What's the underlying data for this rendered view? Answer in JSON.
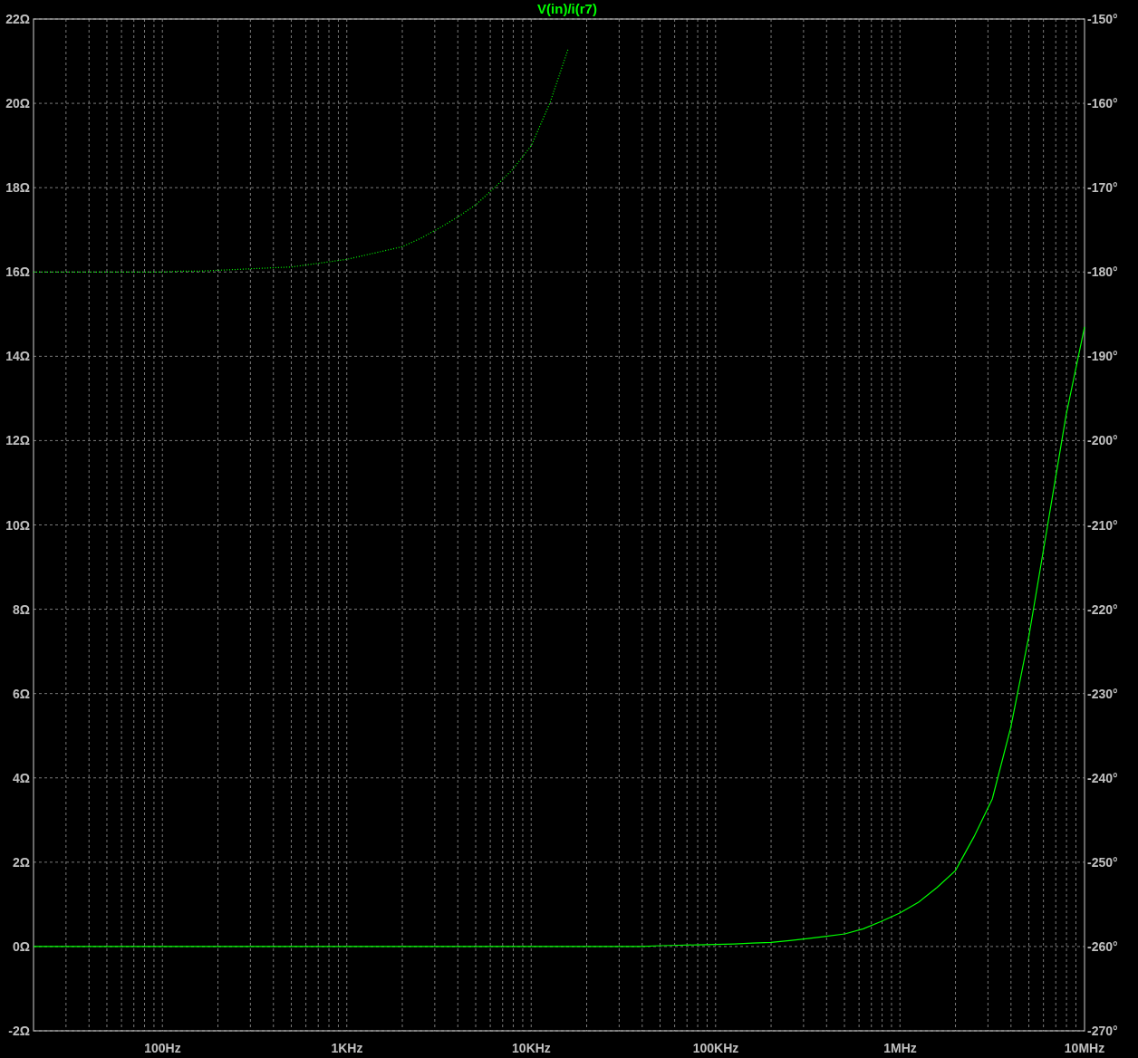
{
  "plot": {
    "chart_data": {
      "type": "line",
      "title": "V(in)/i(r7)",
      "categories": [
        null,
        null,
        null,
        null,
        null,
        null,
        null,
        "100Hz",
        null,
        null,
        null,
        null,
        null,
        null,
        null,
        null,
        null,
        "1KHz",
        null,
        null,
        null,
        null,
        null,
        null,
        null,
        null,
        null,
        "10KHz",
        null,
        null,
        null,
        null,
        null,
        null,
        null,
        null,
        null,
        "100KHz",
        null,
        null,
        null,
        null,
        null,
        null,
        null,
        null,
        null,
        "1MHz",
        null,
        null,
        null,
        null,
        null,
        null,
        null,
        null,
        null,
        "10MHz"
      ],
      "series": [
        {
          "color": "#00ff00",
          "values": [
            0,
            0,
            0,
            0,
            0,
            0,
            0,
            0,
            0,
            0,
            0,
            0,
            0,
            0,
            0,
            0,
            0,
            0,
            0,
            0,
            0,
            0,
            0,
            0,
            0,
            0,
            0,
            0,
            0,
            0,
            0,
            0,
            0,
            0,
            0.02,
            0.03,
            0.04,
            0.05,
            0.06,
            0.08,
            0.1,
            0.14,
            0.19,
            0.24,
            0.3,
            0.42,
            0.6,
            0.8,
            1.05,
            1.4,
            1.8,
            2.6,
            3.5,
            5.2,
            7.4,
            10.0,
            12.6,
            14.7
          ]
        },
        {
          "color": "#00ff00",
          "axis": "y2",
          "line_style": "dotted",
          "values": [
            -180,
            -180,
            -180,
            -180,
            -180,
            -180,
            -180,
            -180,
            -179.9,
            -179.9,
            -179.8,
            -179.7,
            -179.6,
            -179.5,
            -179.4,
            -179.1,
            -178.8,
            -178.5,
            -178,
            -177.5,
            -177,
            -176,
            -174.8,
            -173.5,
            -172,
            -170,
            -167.8,
            -165,
            -160,
            -153.5,
            null,
            null,
            null,
            null,
            null,
            null,
            null,
            null,
            null,
            null,
            null,
            null,
            null,
            null,
            null,
            null,
            null,
            null,
            null,
            null,
            null,
            null,
            null,
            null,
            null,
            null,
            null,
            null
          ]
        }
      ],
      "grid": true,
      "ylim": [
        -2,
        22
      ],
      "y2lim": [
        -270,
        -150
      ],
      "yticks": [
        {
          "value": 22,
          "label": "22Ω"
        },
        {
          "value": 20,
          "label": "20Ω"
        },
        {
          "value": 18,
          "label": "18Ω"
        },
        {
          "value": 16,
          "label": "16Ω"
        },
        {
          "value": 14,
          "label": "14Ω"
        },
        {
          "value": 12,
          "label": "12Ω"
        },
        {
          "value": 10,
          "label": "10Ω"
        },
        {
          "value": 8,
          "label": "8Ω"
        },
        {
          "value": 6,
          "label": "6Ω"
        },
        {
          "value": 4,
          "label": "4Ω"
        },
        {
          "value": 2,
          "label": "2Ω"
        },
        {
          "value": 0,
          "label": "0Ω"
        },
        {
          "value": -2,
          "label": "-2Ω"
        }
      ],
      "y2ticks": [
        {
          "value": -150,
          "label": "-150°"
        },
        {
          "value": -160,
          "label": "-160°"
        },
        {
          "value": -170,
          "label": "-170°"
        },
        {
          "value": -180,
          "label": "-180°"
        },
        {
          "value": -190,
          "label": "-190°"
        },
        {
          "value": -200,
          "label": "-200°"
        },
        {
          "value": -210,
          "label": "-210°"
        },
        {
          "value": -220,
          "label": "-220°"
        },
        {
          "value": -230,
          "label": "-230°"
        },
        {
          "value": -240,
          "label": "-240°"
        },
        {
          "value": -250,
          "label": "-250°"
        },
        {
          "value": -260,
          "label": "-260°"
        },
        {
          "value": -270,
          "label": "-270°"
        }
      ]
    }
  }
}
